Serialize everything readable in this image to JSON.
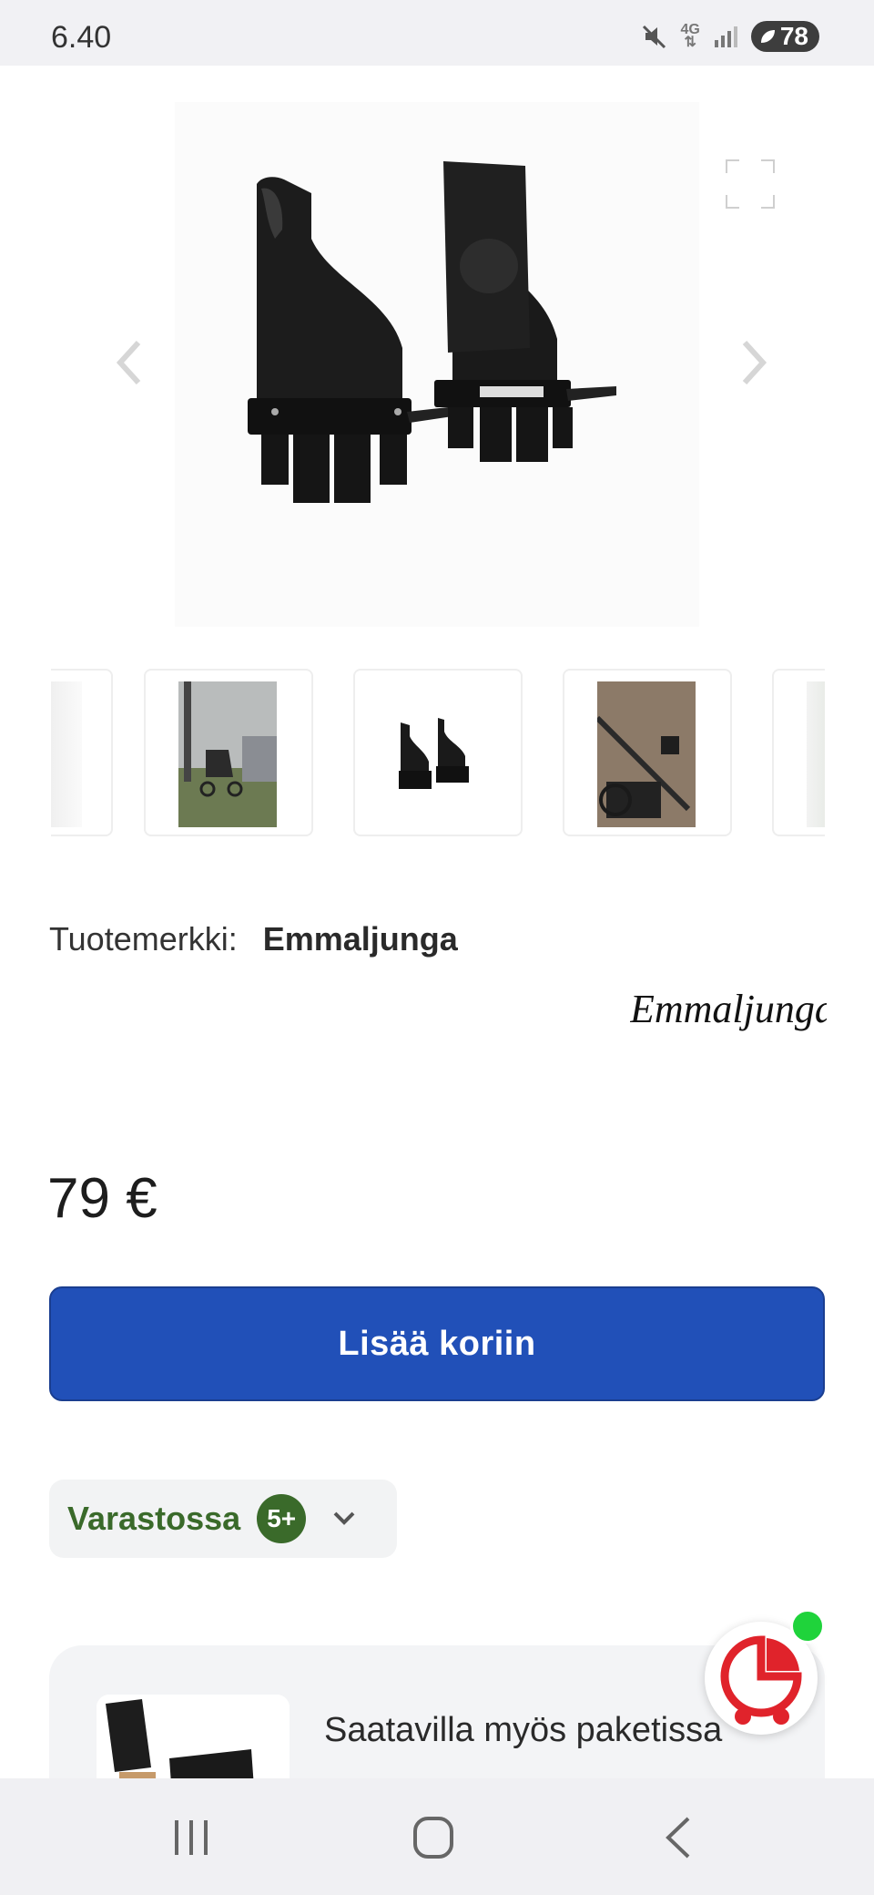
{
  "status_bar": {
    "time": "6.40",
    "network": "4G",
    "battery": "78",
    "icons": [
      "mute-icon",
      "network-4g-icon",
      "signal-icon",
      "battery-icon"
    ]
  },
  "gallery": {
    "main_image_alt": "Emmaljunga adapters",
    "icons": [
      "expand-icon",
      "chevron-left-icon",
      "chevron-right-icon"
    ]
  },
  "thumbnails": [
    {
      "name": "thumbnail-partial-left"
    },
    {
      "name": "thumbnail-stroller-outdoors"
    },
    {
      "name": "thumbnail-adapters"
    },
    {
      "name": "thumbnail-stroller-frame"
    },
    {
      "name": "thumbnail-partial-right"
    }
  ],
  "brand": {
    "label": "Tuotemerkki:",
    "value": "Emmaljunga",
    "logo_text": "Emmaljunga"
  },
  "price": "79 €",
  "cart": {
    "add_label": "Lisää koriin"
  },
  "stock": {
    "label": "Varastossa",
    "badge": "5+"
  },
  "package": {
    "text": "Saatavilla myös paketissa"
  },
  "colors": {
    "primary": "#2150b8",
    "stock_green": "#3a6a2a",
    "online": "#1fd33b",
    "chat_red": "#e0232b"
  }
}
